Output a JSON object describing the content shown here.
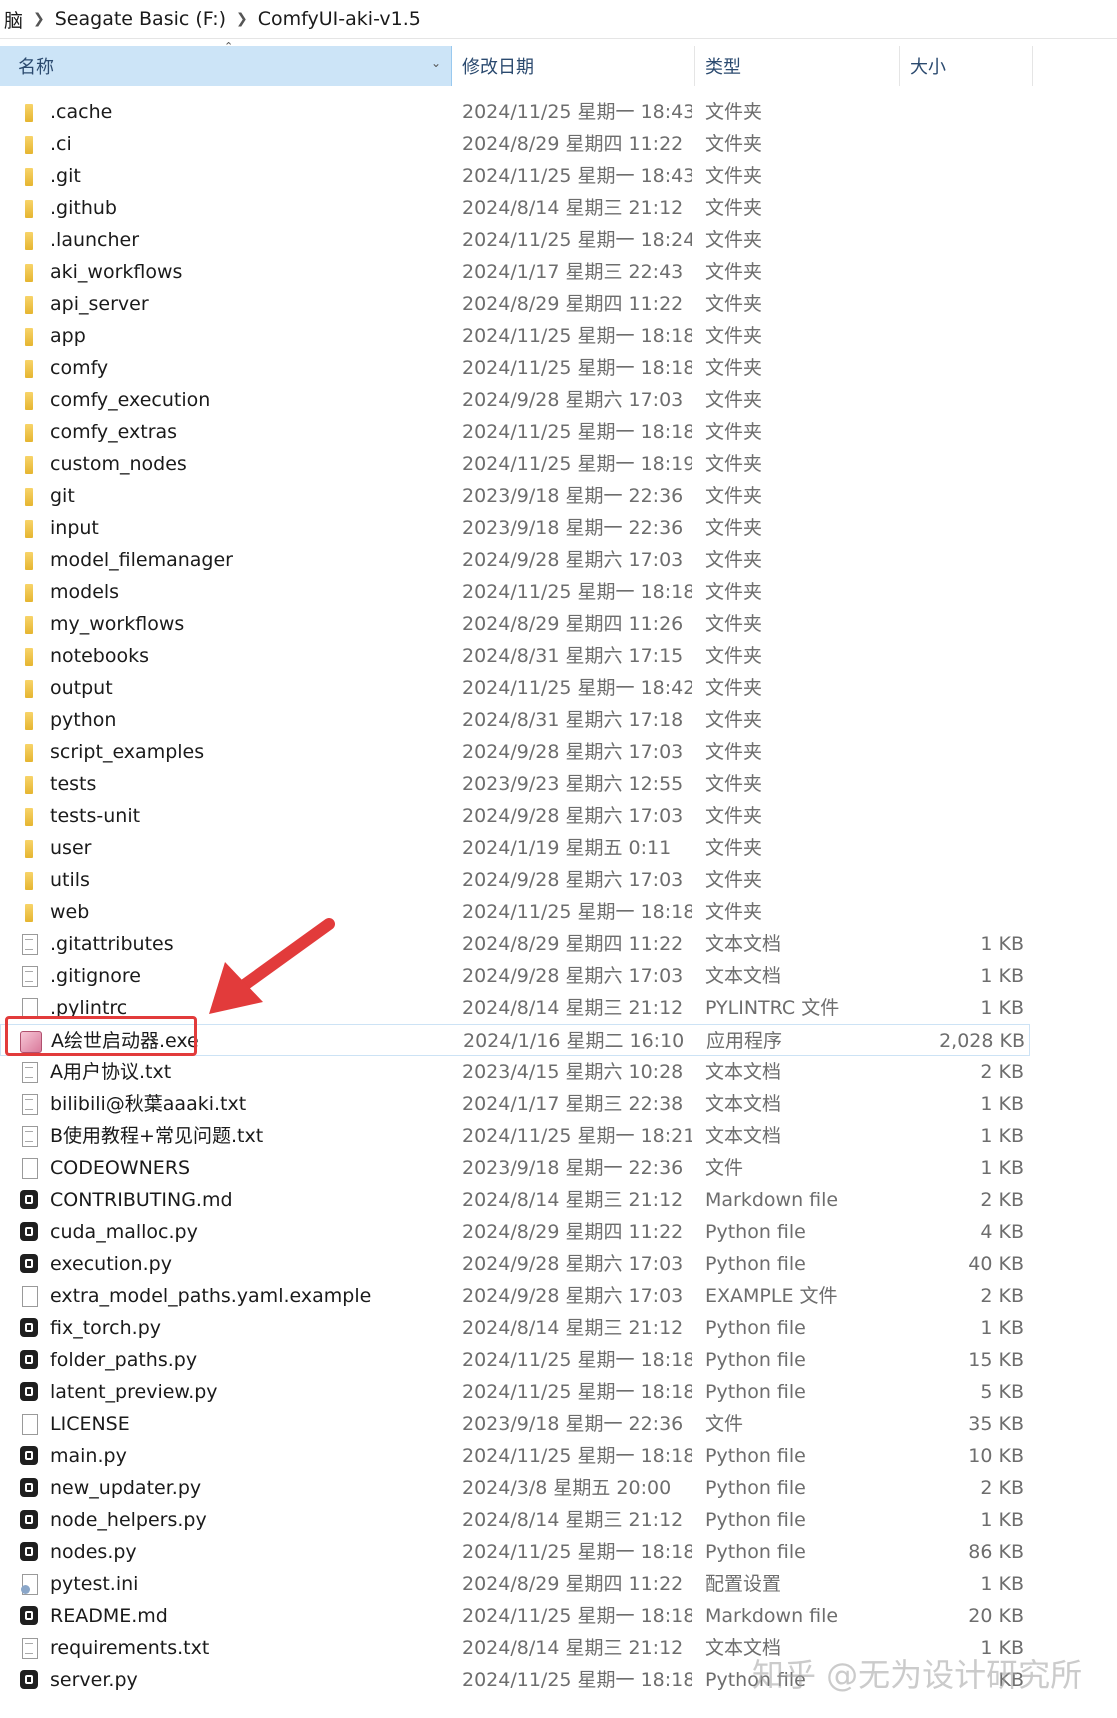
{
  "breadcrumb": {
    "items": [
      "脑",
      "Seagate Basic (F:)",
      "ComfyUI-aki-v1.5"
    ]
  },
  "header": {
    "name": "名称",
    "date": "修改日期",
    "type": "类型",
    "size": "大小"
  },
  "files": [
    {
      "name": ".cache",
      "date": "2024/11/25 星期一 18:43",
      "type": "文件夹",
      "size": "",
      "icon": "folder-icon"
    },
    {
      "name": ".ci",
      "date": "2024/8/29 星期四 11:22",
      "type": "文件夹",
      "size": "",
      "icon": "folder-icon"
    },
    {
      "name": ".git",
      "date": "2024/11/25 星期一 18:43",
      "type": "文件夹",
      "size": "",
      "icon": "folder-icon"
    },
    {
      "name": ".github",
      "date": "2024/8/14 星期三 21:12",
      "type": "文件夹",
      "size": "",
      "icon": "folder-icon"
    },
    {
      "name": ".launcher",
      "date": "2024/11/25 星期一 18:24",
      "type": "文件夹",
      "size": "",
      "icon": "folder-icon"
    },
    {
      "name": "aki_workflows",
      "date": "2024/1/17 星期三 22:43",
      "type": "文件夹",
      "size": "",
      "icon": "folder-icon"
    },
    {
      "name": "api_server",
      "date": "2024/8/29 星期四 11:22",
      "type": "文件夹",
      "size": "",
      "icon": "folder-icon"
    },
    {
      "name": "app",
      "date": "2024/11/25 星期一 18:18",
      "type": "文件夹",
      "size": "",
      "icon": "folder-icon"
    },
    {
      "name": "comfy",
      "date": "2024/11/25 星期一 18:18",
      "type": "文件夹",
      "size": "",
      "icon": "folder-icon"
    },
    {
      "name": "comfy_execution",
      "date": "2024/9/28 星期六 17:03",
      "type": "文件夹",
      "size": "",
      "icon": "folder-icon"
    },
    {
      "name": "comfy_extras",
      "date": "2024/11/25 星期一 18:18",
      "type": "文件夹",
      "size": "",
      "icon": "folder-icon"
    },
    {
      "name": "custom_nodes",
      "date": "2024/11/25 星期一 18:19",
      "type": "文件夹",
      "size": "",
      "icon": "folder-icon"
    },
    {
      "name": "git",
      "date": "2023/9/18 星期一 22:36",
      "type": "文件夹",
      "size": "",
      "icon": "folder-icon"
    },
    {
      "name": "input",
      "date": "2023/9/18 星期一 22:36",
      "type": "文件夹",
      "size": "",
      "icon": "folder-icon"
    },
    {
      "name": "model_filemanager",
      "date": "2024/9/28 星期六 17:03",
      "type": "文件夹",
      "size": "",
      "icon": "folder-icon"
    },
    {
      "name": "models",
      "date": "2024/11/25 星期一 18:18",
      "type": "文件夹",
      "size": "",
      "icon": "folder-icon"
    },
    {
      "name": "my_workflows",
      "date": "2024/8/29 星期四 11:26",
      "type": "文件夹",
      "size": "",
      "icon": "folder-icon"
    },
    {
      "name": "notebooks",
      "date": "2024/8/31 星期六 17:15",
      "type": "文件夹",
      "size": "",
      "icon": "folder-icon"
    },
    {
      "name": "output",
      "date": "2024/11/25 星期一 18:42",
      "type": "文件夹",
      "size": "",
      "icon": "folder-icon"
    },
    {
      "name": "python",
      "date": "2024/8/31 星期六 17:18",
      "type": "文件夹",
      "size": "",
      "icon": "folder-icon"
    },
    {
      "name": "script_examples",
      "date": "2024/9/28 星期六 17:03",
      "type": "文件夹",
      "size": "",
      "icon": "folder-icon"
    },
    {
      "name": "tests",
      "date": "2023/9/23 星期六 12:55",
      "type": "文件夹",
      "size": "",
      "icon": "folder-icon"
    },
    {
      "name": "tests-unit",
      "date": "2024/9/28 星期六 17:03",
      "type": "文件夹",
      "size": "",
      "icon": "folder-icon"
    },
    {
      "name": "user",
      "date": "2024/1/19 星期五 0:11",
      "type": "文件夹",
      "size": "",
      "icon": "folder-icon"
    },
    {
      "name": "utils",
      "date": "2024/9/28 星期六 17:03",
      "type": "文件夹",
      "size": "",
      "icon": "folder-icon"
    },
    {
      "name": "web",
      "date": "2024/11/25 星期一 18:18",
      "type": "文件夹",
      "size": "",
      "icon": "folder-icon"
    },
    {
      "name": ".gitattributes",
      "date": "2024/8/29 星期四 11:22",
      "type": "文本文档",
      "size": "1 KB",
      "icon": "doc-icon"
    },
    {
      "name": ".gitignore",
      "date": "2024/9/28 星期六 17:03",
      "type": "文本文档",
      "size": "1 KB",
      "icon": "doc-icon"
    },
    {
      "name": ".pylintrc",
      "date": "2024/8/14 星期三 21:12",
      "type": "PYLINTRC 文件",
      "size": "1 KB",
      "icon": "blank-icon"
    },
    {
      "name": "A绘世启动器.exe",
      "date": "2024/1/16 星期二 16:10",
      "type": "应用程序",
      "size": "2,028 KB",
      "icon": "app-icon"
    },
    {
      "name": "A用户协议.txt",
      "date": "2023/4/15 星期六 10:28",
      "type": "文本文档",
      "size": "2 KB",
      "icon": "doc-icon"
    },
    {
      "name": "bilibili@秋葉aaaki.txt",
      "date": "2024/1/17 星期三 22:38",
      "type": "文本文档",
      "size": "1 KB",
      "icon": "doc-icon"
    },
    {
      "name": "B使用教程+常见问题.txt",
      "date": "2024/11/25 星期一 18:21",
      "type": "文本文档",
      "size": "1 KB",
      "icon": "doc-icon"
    },
    {
      "name": "CODEOWNERS",
      "date": "2023/9/18 星期一 22:36",
      "type": "文件",
      "size": "1 KB",
      "icon": "blank-icon"
    },
    {
      "name": "CONTRIBUTING.md",
      "date": "2024/8/14 星期三 21:12",
      "type": "Markdown file",
      "size": "2 KB",
      "icon": "py-icon"
    },
    {
      "name": "cuda_malloc.py",
      "date": "2024/8/29 星期四 11:22",
      "type": "Python file",
      "size": "4 KB",
      "icon": "py-icon"
    },
    {
      "name": "execution.py",
      "date": "2024/9/28 星期六 17:03",
      "type": "Python file",
      "size": "40 KB",
      "icon": "py-icon"
    },
    {
      "name": "extra_model_paths.yaml.example",
      "date": "2024/9/28 星期六 17:03",
      "type": "EXAMPLE 文件",
      "size": "2 KB",
      "icon": "blank-icon"
    },
    {
      "name": "fix_torch.py",
      "date": "2024/8/14 星期三 21:12",
      "type": "Python file",
      "size": "1 KB",
      "icon": "py-icon"
    },
    {
      "name": "folder_paths.py",
      "date": "2024/11/25 星期一 18:18",
      "type": "Python file",
      "size": "15 KB",
      "icon": "py-icon"
    },
    {
      "name": "latent_preview.py",
      "date": "2024/11/25 星期一 18:18",
      "type": "Python file",
      "size": "5 KB",
      "icon": "py-icon"
    },
    {
      "name": "LICENSE",
      "date": "2023/9/18 星期一 22:36",
      "type": "文件",
      "size": "35 KB",
      "icon": "blank-icon"
    },
    {
      "name": "main.py",
      "date": "2024/11/25 星期一 18:18",
      "type": "Python file",
      "size": "10 KB",
      "icon": "py-icon"
    },
    {
      "name": "new_updater.py",
      "date": "2024/3/8 星期五 20:00",
      "type": "Python file",
      "size": "2 KB",
      "icon": "py-icon"
    },
    {
      "name": "node_helpers.py",
      "date": "2024/8/14 星期三 21:12",
      "type": "Python file",
      "size": "1 KB",
      "icon": "py-icon"
    },
    {
      "name": "nodes.py",
      "date": "2024/11/25 星期一 18:18",
      "type": "Python file",
      "size": "86 KB",
      "icon": "py-icon"
    },
    {
      "name": "pytest.ini",
      "date": "2024/8/29 星期四 11:22",
      "type": "配置设置",
      "size": "1 KB",
      "icon": "ini-icon"
    },
    {
      "name": "README.md",
      "date": "2024/11/25 星期一 18:18",
      "type": "Markdown file",
      "size": "20 KB",
      "icon": "py-icon"
    },
    {
      "name": "requirements.txt",
      "date": "2024/8/14 星期三 21:12",
      "type": "文本文档",
      "size": "1 KB",
      "icon": "doc-icon"
    },
    {
      "name": "server.py",
      "date": "2024/11/25 星期一 18:18",
      "type": "Python file",
      "size": "KB",
      "icon": "py-icon"
    }
  ],
  "watermark": "知乎 @无为设计研究所",
  "colors": {
    "header_bg": "#cce4f7",
    "highlight": "#e23b3b",
    "folder": "#f0c342"
  }
}
